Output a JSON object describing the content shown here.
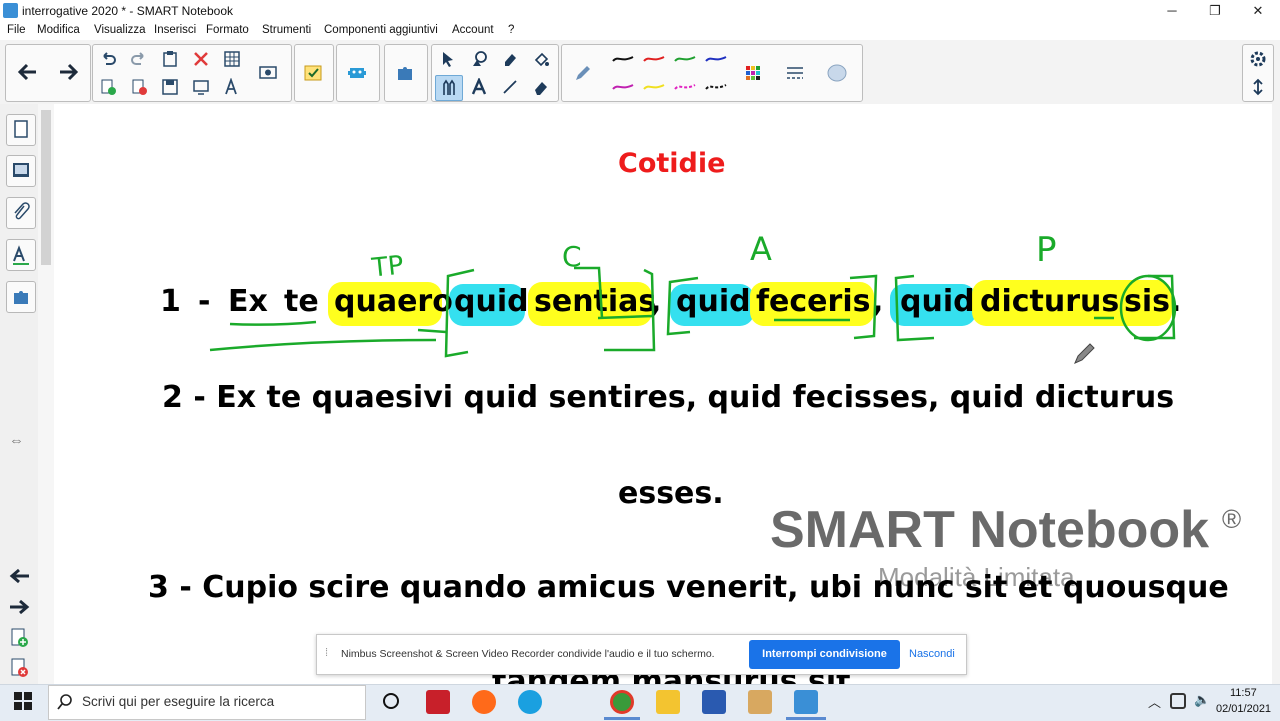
{
  "window": {
    "title": "interrogative 2020 * - SMART Notebook",
    "minimize": "─",
    "maximize": "❐",
    "close": "✕"
  },
  "menu": [
    "File",
    "Modifica",
    "Visualizza",
    "Inserisci",
    "Formato",
    "Strumenti",
    "Componenti aggiuntivi",
    "Account",
    "?"
  ],
  "canvas": {
    "heading": "Cotidie",
    "heading_color": "#ee1c1c",
    "annotations": {
      "tp": "TP",
      "c": "C",
      "a": "A",
      "p": "P"
    },
    "line1": {
      "number": "1",
      "dash": "-",
      "words": [
        "Ex",
        "te",
        "quaero",
        "quid",
        "sentias",
        ",",
        "quid",
        "feceris",
        ",",
        "quid",
        "dicturus",
        "sis",
        "."
      ]
    },
    "line2": {
      "text": "2 - Ex te quaesivi quid sentires, quid fecisses, quid dicturus",
      "continuation": "esses."
    },
    "line3": {
      "text": "3 - Cupio scire quando amicus venerit, ubi nunc sit et quousque",
      "partial": "tandem mansurus sit"
    },
    "watermark": {
      "brand": "SMART Notebook",
      "reg": "®",
      "subtitle": "Modalità Limitata"
    }
  },
  "notification": {
    "message": "Nimbus Screenshot & Screen Video Recorder condivide l'audio e il tuo schermo.",
    "stop_button": "Interrompi condivisione",
    "hide_link": "Nascondi"
  },
  "taskbar": {
    "search_placeholder": "Scrivi qui per eseguire la ricerca",
    "time": "11:57",
    "date": "02/01/2021"
  },
  "colors": {
    "yellow_highlight": "#ffff1e",
    "cyan_highlight": "#35e0ef",
    "ink_green": "#1aaa2a",
    "accent_blue": "#1a73e8"
  }
}
